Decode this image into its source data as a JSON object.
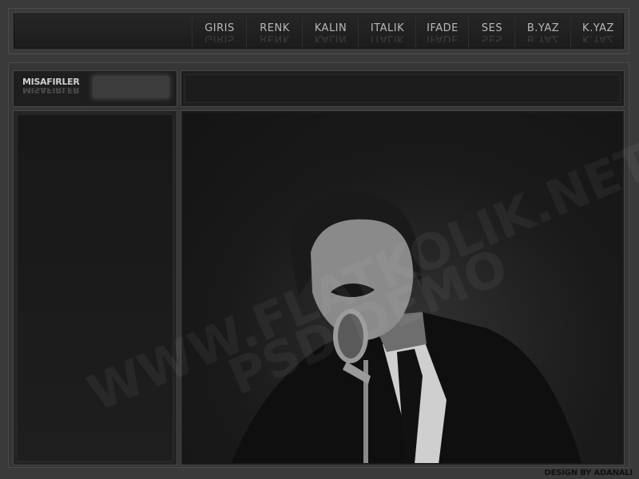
{
  "nav": {
    "items": [
      {
        "label": "GIRIS"
      },
      {
        "label": "RENK"
      },
      {
        "label": "KALIN"
      },
      {
        "label": "ITALIK"
      },
      {
        "label": "IFADE"
      },
      {
        "label": "SES"
      },
      {
        "label": "B.YAZ"
      },
      {
        "label": "K.YAZ"
      }
    ]
  },
  "guests": {
    "label": "MISAFIRLER",
    "input_value": ""
  },
  "watermark": {
    "line1": "WWW.FLATKOLIK.NET",
    "line2": "PSD DEMO"
  },
  "footer": {
    "credit": "DESIGN BY ADANALI"
  },
  "colors": {
    "background": "#3a3a3a",
    "panel": "#1e1e1e",
    "nav_text": "#b8b8b8"
  }
}
